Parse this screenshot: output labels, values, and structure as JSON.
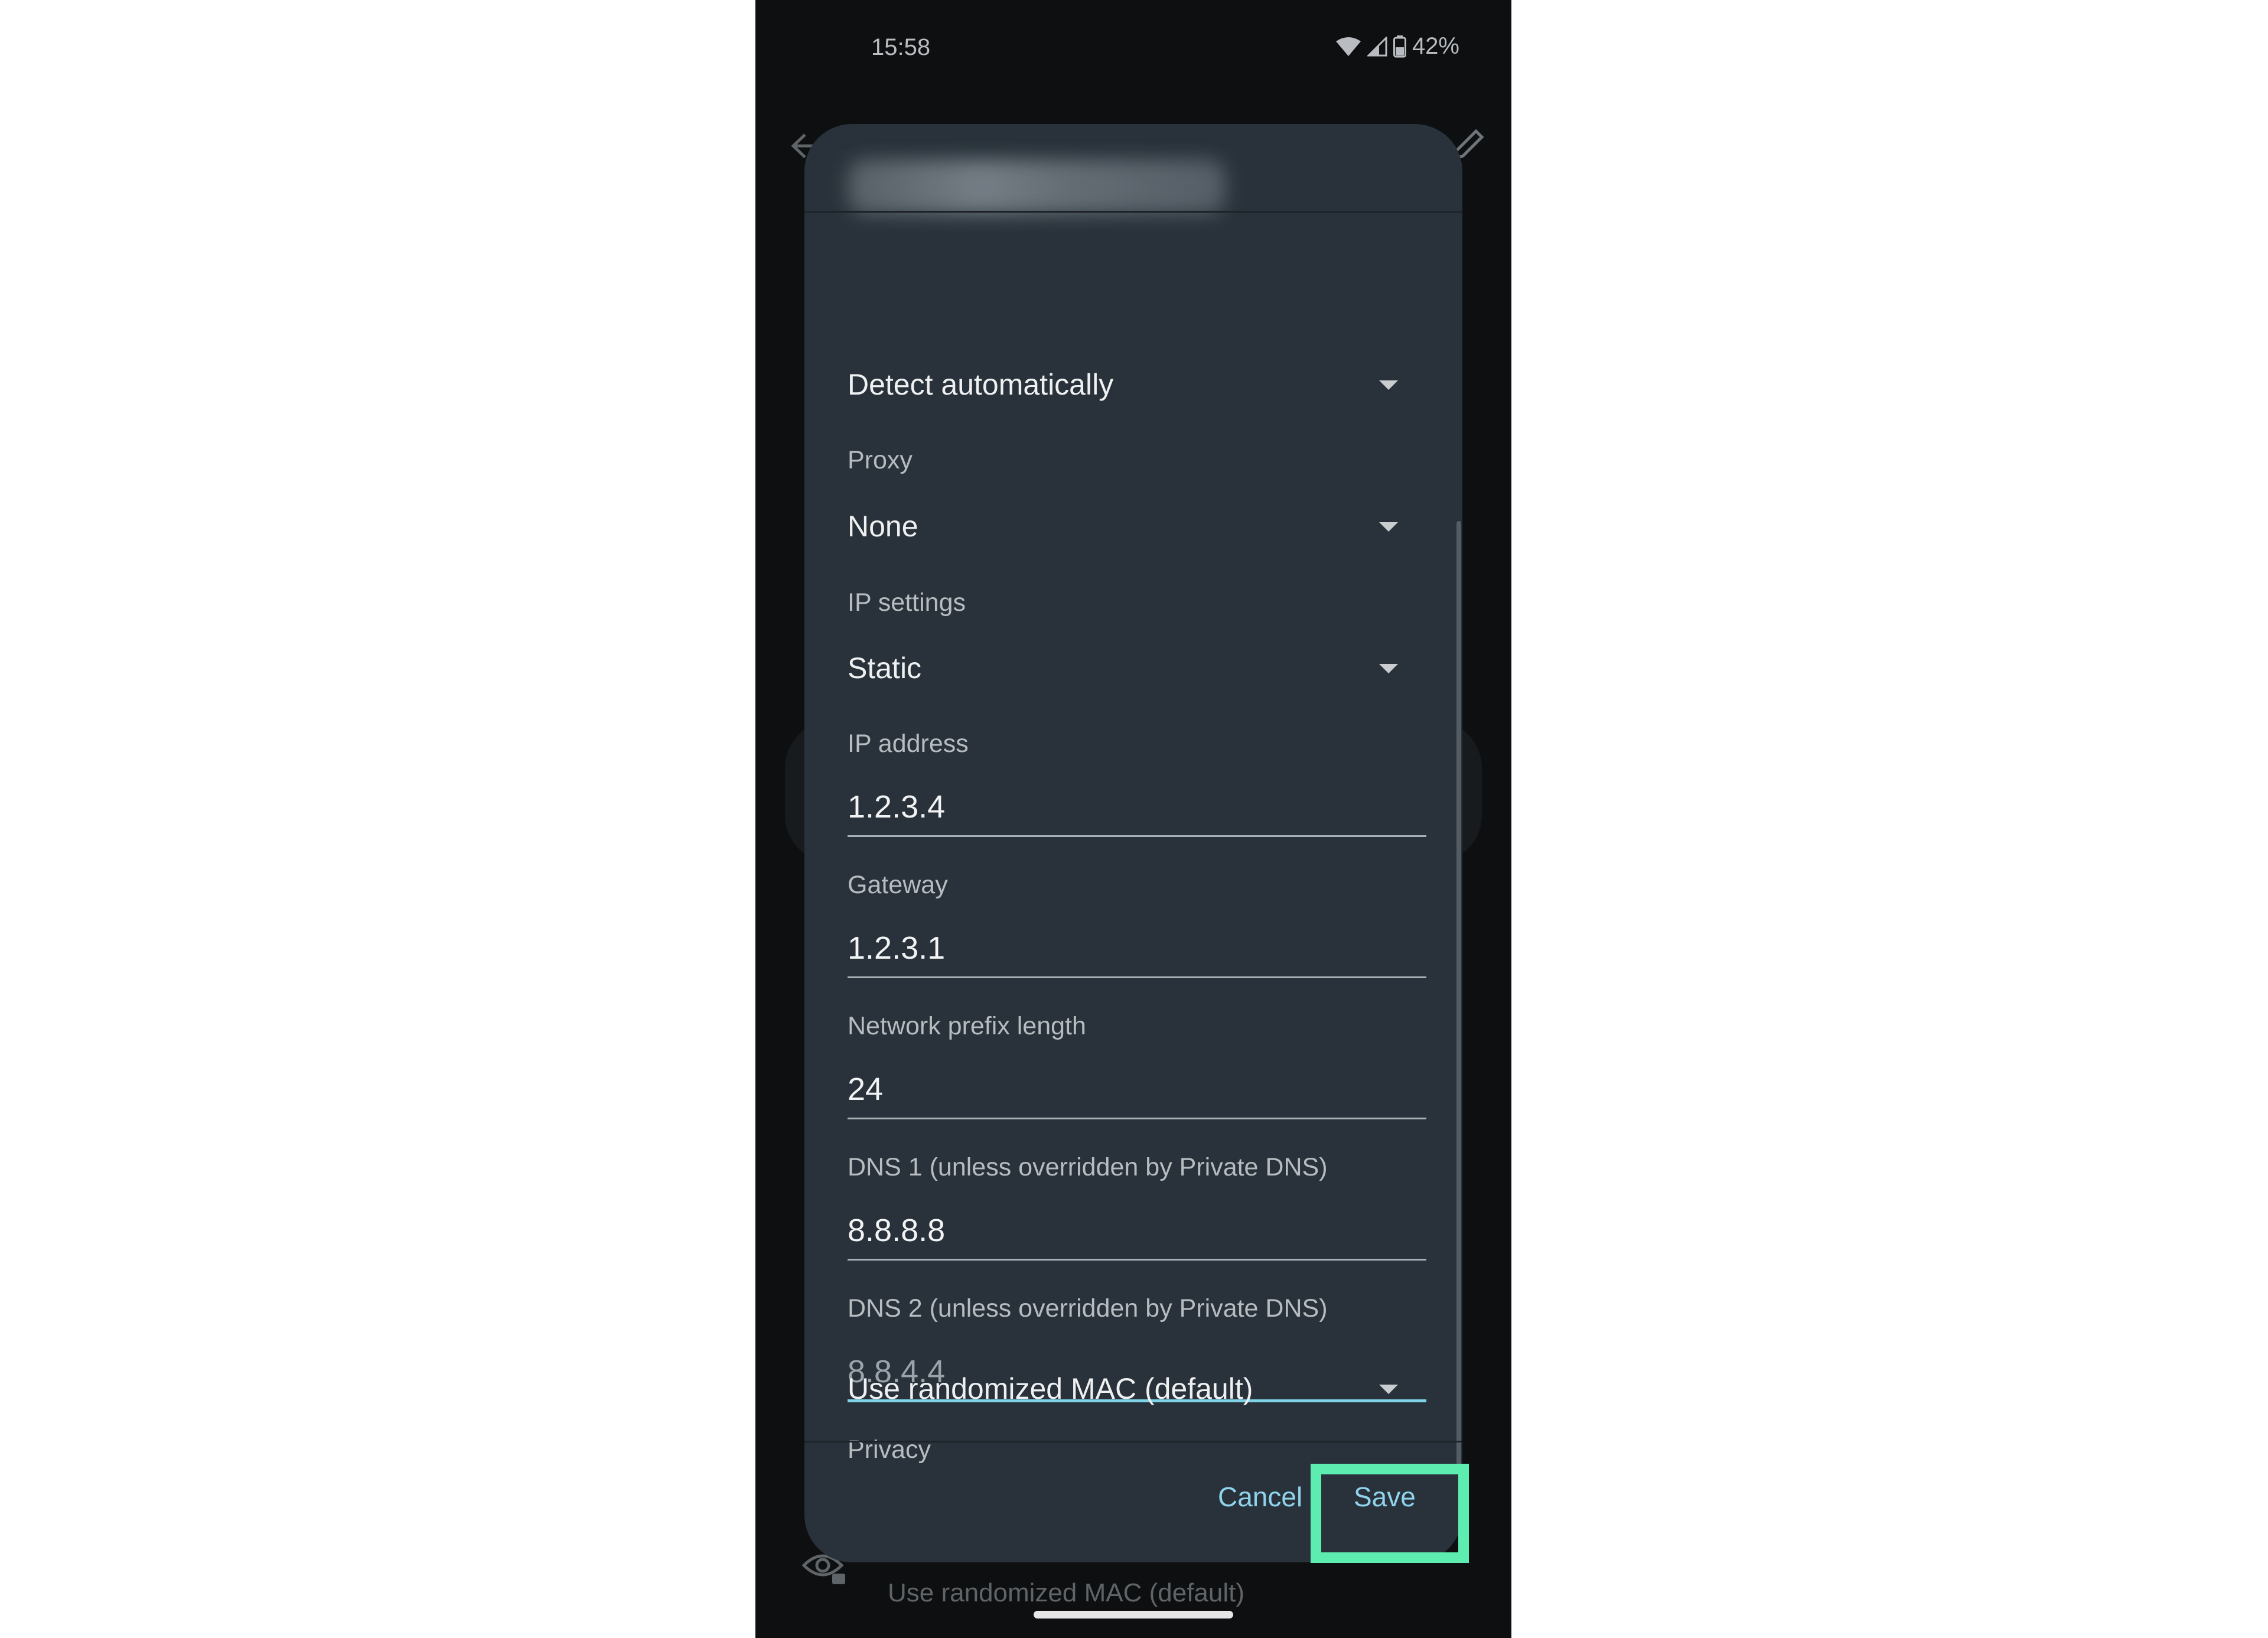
{
  "status_bar": {
    "time": "15:58",
    "battery": "42%"
  },
  "dialog": {
    "proxy_autoconfig_value": "Detect automatically",
    "proxy": {
      "label": "Proxy",
      "value": "None"
    },
    "ip_settings": {
      "label": "IP settings",
      "value": "Static"
    },
    "ip_address": {
      "label": "IP address",
      "value": "1.2.3.4"
    },
    "gateway": {
      "label": "Gateway",
      "value": "1.2.3.1"
    },
    "prefix": {
      "label": "Network prefix length",
      "value": "24"
    },
    "dns1": {
      "label": "DNS 1 (unless overridden by Private DNS)",
      "value": "8.8.8.8"
    },
    "dns2": {
      "label": "DNS 2 (unless overridden by Private DNS)",
      "placeholder": "8.8.4.4"
    },
    "privacy": {
      "label": "Privacy",
      "value": "Use randomized MAC (default)"
    },
    "cancel_label": "Cancel",
    "save_label": "Save"
  },
  "background": {
    "privacy_value": "Use randomized MAC (default)"
  },
  "colors": {
    "dialog_bg": "#29323a",
    "accent": "#8fd3ec",
    "highlight": "#5dedb0"
  }
}
